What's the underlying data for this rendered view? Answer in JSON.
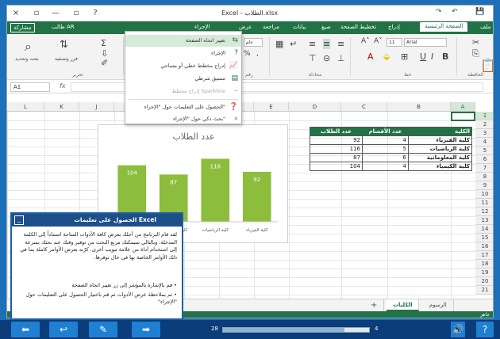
{
  "window": {
    "title": "Excel - الطلاب.xlsx",
    "controls": [
      "×",
      "▫",
      "—",
      "▫",
      "?"
    ],
    "quick_access": [
      "↷",
      "↶",
      "💾"
    ]
  },
  "ribbon_tabs": {
    "file": "ملف",
    "items": [
      "الصفحة الرئيسية",
      "إدراج",
      "تخطيط الصفحة",
      "صيغ",
      "بيانات",
      "مراجعة",
      "عرض"
    ],
    "tell_me": "الإجراء",
    "share": "مشاركة",
    "user": "طالب AR"
  },
  "ribbon": {
    "font_name": "Arial",
    "font_size": "11",
    "number_format": "عام",
    "group_labels": {
      "clipboard": "الحافظة",
      "font": "خط",
      "alignment": "محاذاة",
      "number": "رقم",
      "editing": "تحرير"
    },
    "editing_sort": "فرز وتصفية",
    "editing_find": "بحث وتحديد"
  },
  "tell_me_menu": {
    "items": [
      {
        "label": "تغيير اتجاه الصفحة",
        "icon": "page-orientation-icon",
        "highlighted": true,
        "disabled": false
      },
      {
        "label": "الإجراء",
        "icon": "question-icon",
        "highlighted": false,
        "disabled": false
      },
      {
        "label": "إدراج مخطط خطي أو مساحي",
        "icon": "line-chart-icon",
        "highlighted": false,
        "disabled": false
      },
      {
        "label": "تنسيق شرطي",
        "icon": "conditional-format-icon",
        "highlighted": false,
        "disabled": false
      },
      {
        "label": "إدراج مخطط Sparkline",
        "icon": "sparkline-icon",
        "highlighted": false,
        "disabled": true
      },
      {
        "label": "الحصول على التعليمات حول \"الإجراء\"",
        "icon": "help-icon",
        "highlighted": false,
        "disabled": false
      },
      {
        "label": "بحث ذكي حول \"الإجراء\"",
        "icon": "search-icon",
        "highlighted": false,
        "disabled": false
      }
    ]
  },
  "formula_bar": {
    "name_box": "A1",
    "fx": "fx"
  },
  "columns": [
    "A",
    "B",
    "C",
    "D",
    "E",
    "F",
    "G",
    "H",
    "I",
    "J",
    "K",
    "L"
  ],
  "rows": [
    "1",
    "2",
    "3",
    "4",
    "5",
    "6",
    "7",
    "8",
    "9",
    "10",
    "11",
    "12",
    "13",
    "14",
    "15",
    "16",
    "17",
    "18",
    "19",
    "20",
    "21"
  ],
  "table": {
    "headers": [
      "الكلية",
      "عدد الأقسام",
      "عدد الطلاب"
    ],
    "rows": [
      {
        "name": "كلية الفيزياء",
        "departments": "4",
        "students": "92"
      },
      {
        "name": "كلية الرياضيات",
        "departments": "5",
        "students": "116"
      },
      {
        "name": "كلية المعلوماتية",
        "departments": "6",
        "students": "87"
      },
      {
        "name": "كلية الكيمياء",
        "departments": "4",
        "students": "104"
      }
    ]
  },
  "chart_data": {
    "type": "bar",
    "title": "عدد الطلاب",
    "categories": [
      "كلية الفيزياء",
      "كلية الرياضيات",
      "كلية المعلوماتية",
      "كلية الكيمياء"
    ],
    "values": [
      92,
      116,
      87,
      104
    ],
    "order_left_to_right": [
      3,
      2,
      1,
      0
    ],
    "ylim": [
      0,
      140
    ],
    "grid": false,
    "bar_color": "#8cbd3c"
  },
  "sheets": {
    "tabs": [
      "الكليات",
      "الرسوم"
    ],
    "active": "الكليات",
    "add": "+"
  },
  "status": {
    "ready": "جاهز"
  },
  "help_pane": {
    "title": "الحصول على تعليمات Excel",
    "body": "لقد قام البرنامج من أجلك بعرض كافة الأدوات المتاحة استناداً إلى الكلمة المدخلة، وبالتالي سيمكنك مربع البحث من توفير وقتك عند بحثك بسرعة إلى استخدام أداة من علامة تبويب أخرى. كرّنه بعرض الأوامر كاملة بما في ذلك الأوامر الخاصة بها في حال توفرها.",
    "bullets": [
      "قم بالإشارة بالمؤشر إلى زر تغيير اتجاه الصفحة",
      "ثم بملاحظة عرض الأدوات ثم قم باختيار الحصول على التعليمات حول \"الإجراء\""
    ]
  },
  "navbar": {
    "prev_label": "⬅",
    "back_label": "↩",
    "edit_label": "✎",
    "next_label": "➡",
    "page_current": "4",
    "page_total": "28",
    "progress_fraction": 0.83,
    "sound_label": "🔊",
    "help_label": "?"
  }
}
